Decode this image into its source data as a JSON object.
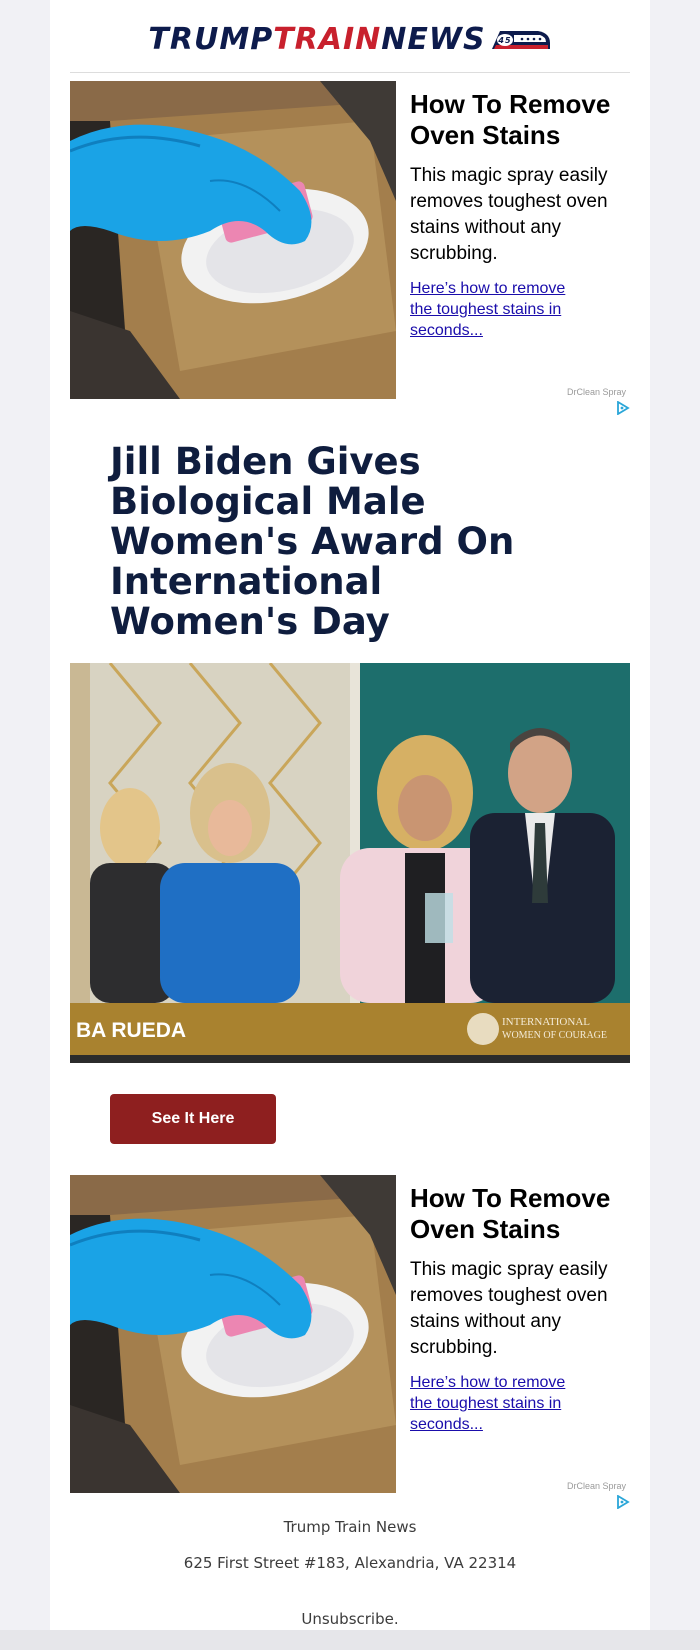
{
  "logo": {
    "word1": "TRUMP",
    "word2": "TRAIN",
    "word3": "NEWS",
    "badge": "45"
  },
  "ad_top": {
    "title": "How To Remove Oven Stains",
    "description": "This magic spray easily removes toughest oven stains without any scrubbing.",
    "link": "Here’s how to remove the toughest stains in seconds...",
    "sponsor": "DrClean Spray",
    "image": "oven-cleaning-glove-sponge"
  },
  "article": {
    "headline": "Jill Biden Gives Biological Male Women's Award On International Women's Day",
    "image": "award-ceremony-photo",
    "image_caption_left": "BA RUEDA",
    "image_caption_right_line1": "INTERNATIONAL",
    "image_caption_right_line2": "WOMEN OF COURAGE",
    "cta_label": "See It Here"
  },
  "ad_bottom": {
    "title": "How To Remove Oven Stains",
    "description": "This magic spray easily removes toughest oven stains without any scrubbing.",
    "link": "Here’s how to remove the toughest stains in seconds...",
    "sponsor": "DrClean Spray",
    "image": "oven-cleaning-glove-sponge"
  },
  "footer": {
    "name": "Trump Train News",
    "address": "625 First Street #183, Alexandria, VA 22314",
    "unsubscribe": "Unsubscribe."
  },
  "colors": {
    "navy": "#0d1b4c",
    "red": "#c8202d",
    "cta": "#8e1f1f",
    "link": "#1a0dab"
  }
}
